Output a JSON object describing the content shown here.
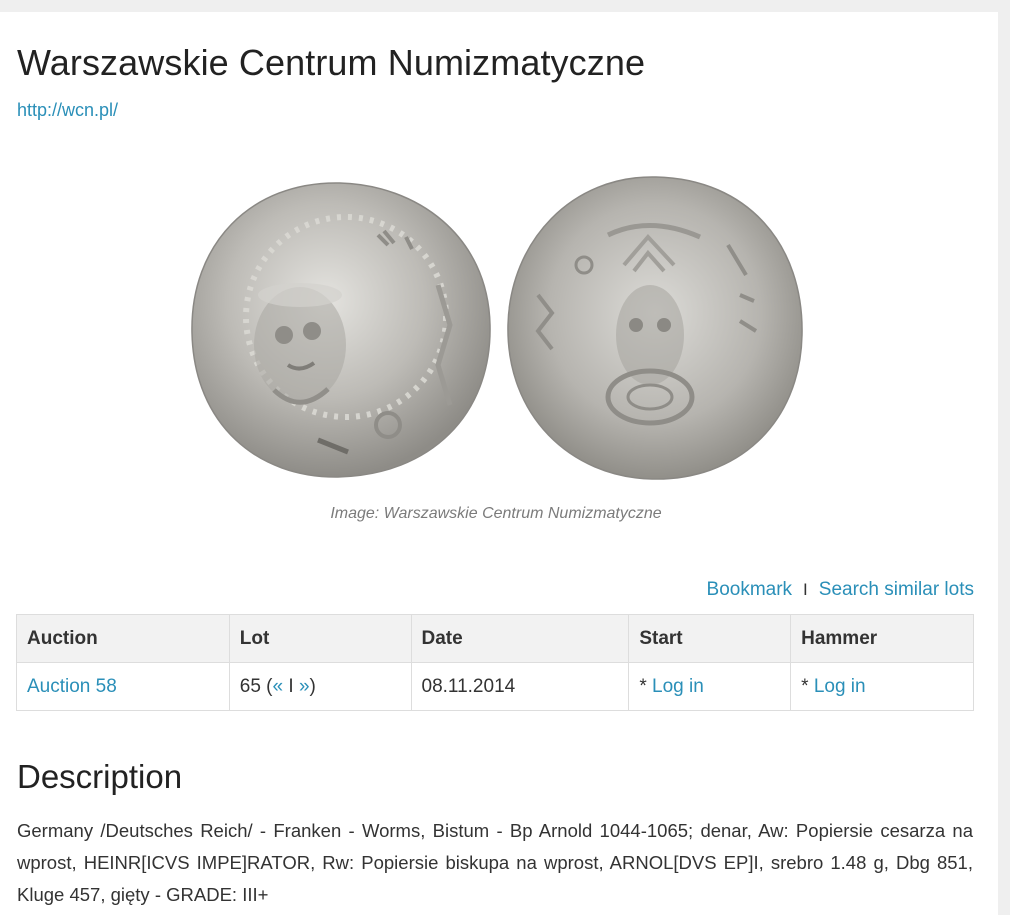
{
  "header": {
    "title": "Warszawskie Centrum Numizmatyczne",
    "url_text": "http://wcn.pl/"
  },
  "image": {
    "caption": "Image: Warszawskie Centrum Numizmatyczne"
  },
  "actions": {
    "bookmark": "Bookmark",
    "separator": "I",
    "search_similar": "Search similar lots"
  },
  "table": {
    "headers": [
      "Auction",
      "Lot",
      "Date",
      "Start",
      "Hammer"
    ],
    "row": {
      "auction": "Auction 58",
      "lot_number": "65",
      "lot_open": " (",
      "prev": "«",
      "lot_sep": " I ",
      "next": "»",
      "lot_close": ")",
      "date": "08.11.2014",
      "start_prefix": "* ",
      "start_link": "Log in",
      "hammer_prefix": "* ",
      "hammer_link": "Log in"
    }
  },
  "description": {
    "heading": "Description",
    "text": "Germany /Deutsches Reich/ - Franken - Worms, Bistum - Bp Arnold 1044-1065; denar, Aw: Popiersie cesarza na wprost, HEINR[ICVS IMPE]RATOR, Rw: Popiersie biskupa na wprost, ARNOL[DVS EP]I, srebro 1.48 g, Dbg 851, Kluge 457, gięty - GRADE: III+"
  },
  "colors": {
    "link": "#2a8fb8",
    "page_bg": "#efefef",
    "header_row_bg": "#f2f2f2",
    "coin_silver": "#b9b7b2"
  }
}
